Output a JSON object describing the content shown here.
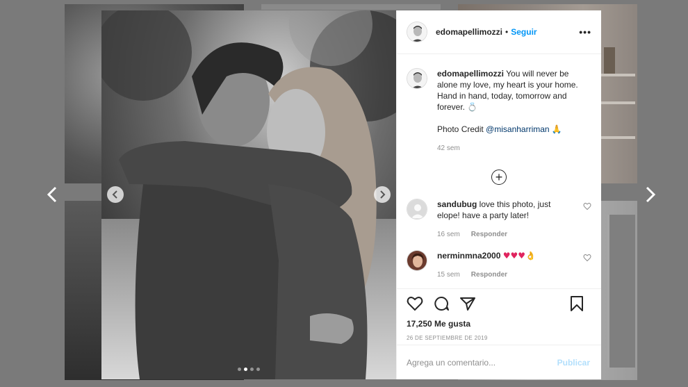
{
  "post": {
    "username": "edomapellimozzi",
    "separator": "•",
    "follow_label": "Seguir",
    "more_label": "•••",
    "caption_line1": "You will never be alone my love, my heart is your home. Hand in hand, today, tomorrow and forever. 💍",
    "caption_credit_prefix": "Photo Credit ",
    "caption_mention": "@misanharriman",
    "caption_credit_suffix": " 🙏",
    "caption_age": "42 sem",
    "load_more_label": "+",
    "likes": "17,250 Me gusta",
    "date": "26 DE SEPTIEMBRE DE 2019",
    "slides_total": 4,
    "slide_active": 2
  },
  "comments": [
    {
      "user": "sandubug",
      "text": "love this photo, just elope! have a party later!",
      "age": "16 sem",
      "reply": "Responder"
    },
    {
      "user": "nerminmna2000",
      "text": "♥♥♥👌",
      "age": "15 sem",
      "reply": "Responder"
    }
  ],
  "composer": {
    "placeholder": "Agrega un comentario...",
    "publish_label": "Publicar"
  },
  "icons": [
    "heart-icon",
    "comment-icon",
    "share-icon",
    "bookmark-icon",
    "chevron-left-icon",
    "chevron-right-icon",
    "plus-circle-icon",
    "more-icon"
  ],
  "colors": {
    "link": "#0095f6",
    "publish_disabled": "#b2dffc",
    "meta": "#8e8e8e",
    "mention": "#00376b"
  }
}
